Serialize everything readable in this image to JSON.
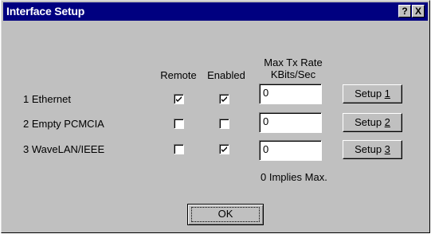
{
  "window": {
    "title": "Interface Setup"
  },
  "titlebar_buttons": {
    "help": "?",
    "close": "X"
  },
  "headers": {
    "remote": "Remote",
    "enabled": "Enabled",
    "max_line1": "Max Tx Rate",
    "max_line2": "KBits/Sec"
  },
  "rows": [
    {
      "label": "1  Ethernet",
      "remote": true,
      "enabled": true,
      "rate": "0",
      "setup_prefix": "Setup ",
      "setup_key": "1"
    },
    {
      "label": "2  Empty PCMCIA",
      "remote": false,
      "enabled": false,
      "rate": "0",
      "setup_prefix": "Setup ",
      "setup_key": "2"
    },
    {
      "label": "3  WaveLAN/IEEE",
      "remote": false,
      "enabled": true,
      "rate": "0",
      "setup_prefix": "Setup ",
      "setup_key": "3"
    }
  ],
  "note": "0 Implies Max.",
  "ok_label": "OK",
  "colors": {
    "titlebar": "#000080",
    "face": "#c0c0c0"
  }
}
